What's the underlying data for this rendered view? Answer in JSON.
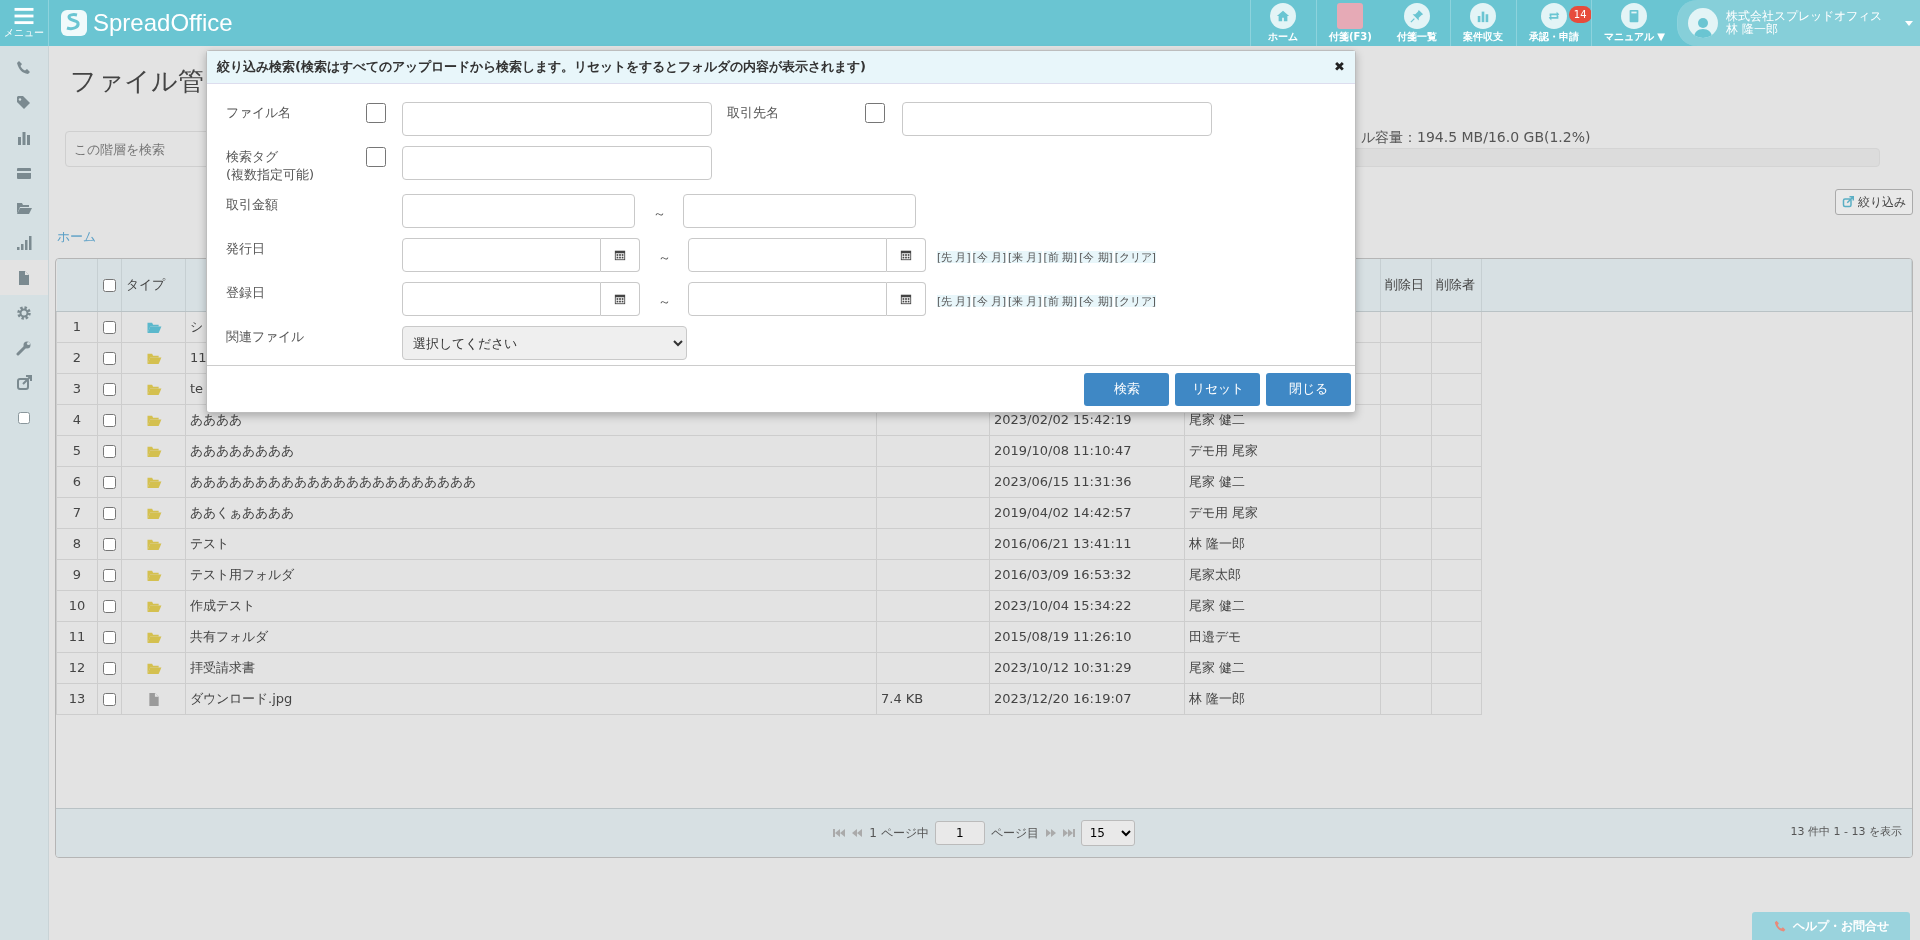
{
  "header": {
    "menu_label": "メニュー",
    "logo": "SpreadOffice",
    "nav": [
      {
        "kind": "home",
        "label": "ホーム"
      },
      {
        "kind": "sticky",
        "label": "付箋(F3)"
      },
      {
        "kind": "pin",
        "label": "付箋一覧"
      },
      {
        "kind": "chart",
        "label": "案件収支"
      },
      {
        "kind": "approval",
        "label": "承認・申請",
        "badge": "14"
      },
      {
        "kind": "manual",
        "label": "マニュアル ▼"
      }
    ],
    "user": {
      "company": "株式会社スプレッドオフィス",
      "name": "林 隆一郎"
    }
  },
  "sidebar": {
    "items": [
      {
        "kind": "phone",
        "selected": false
      },
      {
        "kind": "tag",
        "selected": false
      },
      {
        "kind": "chart",
        "selected": false
      },
      {
        "kind": "card",
        "selected": false
      },
      {
        "kind": "folder",
        "selected": false
      },
      {
        "kind": "signal",
        "selected": false
      },
      {
        "kind": "file",
        "selected": true
      },
      {
        "kind": "gear",
        "selected": false
      },
      {
        "kind": "wrench",
        "selected": false
      },
      {
        "kind": "external",
        "selected": false
      },
      {
        "kind": "square",
        "selected": false
      }
    ]
  },
  "page": {
    "title": "ファイル管",
    "search_placeholder": "この階層を検索",
    "storage": {
      "label": "ル容量：194.5 MB/16.0 GB(1.2%)",
      "level": 0.012
    },
    "filter_button": "絞り込み",
    "breadcrumb": "ホーム"
  },
  "table": {
    "header": {
      "select_all_checked": false,
      "type": "タイプ",
      "deleted_at": "削除日",
      "deleted_by": "削除者"
    },
    "rows": [
      {
        "no": "1",
        "checked": false,
        "kind": "shared",
        "name": "シ"
      },
      {
        "no": "2",
        "checked": false,
        "kind": "folder",
        "name": "11"
      },
      {
        "no": "3",
        "checked": false,
        "kind": "folder",
        "name": "te"
      },
      {
        "no": "4",
        "checked": false,
        "kind": "folder",
        "name": "ああああ",
        "date": "2023/02/02 15:42:19",
        "user": "尾家 健二"
      },
      {
        "no": "5",
        "checked": false,
        "kind": "folder",
        "name": "ああああああああ",
        "date": "2019/10/08 11:10:47",
        "user": "デモ用 尾家"
      },
      {
        "no": "6",
        "checked": false,
        "kind": "folder",
        "name": "ああああああああああああああああああああああ",
        "date": "2023/06/15 11:31:36",
        "user": "尾家 健二"
      },
      {
        "no": "7",
        "checked": false,
        "kind": "folder",
        "name": "ああくぁああああ",
        "date": "2019/04/02 14:42:57",
        "user": "デモ用 尾家"
      },
      {
        "no": "8",
        "checked": false,
        "kind": "folder",
        "name": "テスト",
        "date": "2016/06/21 13:41:11",
        "user": "林 隆一郎"
      },
      {
        "no": "9",
        "checked": false,
        "kind": "folder",
        "name": "テスト用フォルダ",
        "date": "2016/03/09 16:53:32",
        "user": "尾家太郎"
      },
      {
        "no": "10",
        "checked": false,
        "kind": "folder",
        "name": "作成テスト",
        "date": "2023/10/04 15:34:22",
        "user": "尾家 健二"
      },
      {
        "no": "11",
        "checked": false,
        "kind": "folder",
        "name": "共有フォルダ",
        "date": "2015/08/19 11:26:10",
        "user": "田邉デモ"
      },
      {
        "no": "12",
        "checked": false,
        "kind": "folder",
        "name": "拝受請求書",
        "date": "2023/10/12 10:31:29",
        "user": "尾家 健二"
      },
      {
        "no": "13",
        "checked": false,
        "kind": "file",
        "name": "ダウンロード.jpg",
        "size": "7.4 KB",
        "date": "2023/12/20 16:19:07",
        "user": "林 隆一郎"
      }
    ]
  },
  "pagination": {
    "page_prefix": "1 ページ中",
    "page": "1",
    "page_suffix": "ページ目",
    "per_page": "15",
    "summary": "13 件中 1 - 13 を表示"
  },
  "help_button": "ヘルプ・お問合せ",
  "modal": {
    "title": "絞り込み検索(検索はすべてのアップロードから検索します。リセットをするとフォルダの内容が表示されます)",
    "close": "✖",
    "file_name": {
      "label": "ファイル名",
      "checked": false
    },
    "partner": {
      "label": "取引先名",
      "checked": false
    },
    "tags": {
      "label": "検索タグ",
      "sublabel": "(複数指定可能)",
      "checked": false
    },
    "amount": {
      "label": "取引金額",
      "separator": "～"
    },
    "dates": [
      {
        "label": "発行日",
        "separator": "～",
        "shortcuts": [
          "[先 月]",
          "[今 月]",
          "[来 月]",
          "[前 期]",
          "[今 期]",
          "[クリア]"
        ]
      },
      {
        "label": "登録日",
        "separator": "～",
        "shortcuts": [
          "[先 月]",
          "[今 月]",
          "[来 月]",
          "[前 期]",
          "[今 期]",
          "[クリア]"
        ]
      }
    ],
    "related": {
      "label": "関連ファイル",
      "value": "選択してください"
    },
    "buttons": [
      "検索",
      "リセット",
      "閉じる"
    ]
  }
}
